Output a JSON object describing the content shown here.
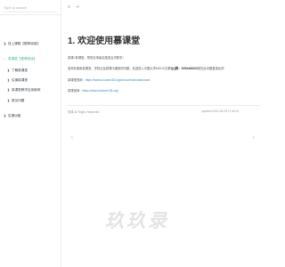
{
  "sidebar": {
    "search_placeholder": "Type to search",
    "items": [
      {
        "label": "线上课程【推荐阅读】",
        "caret": "❯",
        "active": false
      },
      {
        "label": "慕课堂【推荐阅读】",
        "caret": "⌄",
        "active": true
      },
      {
        "label": "了解慕课堂",
        "caret": "❯",
        "active": false
      },
      {
        "label": "实操慕课堂",
        "caret": "❯",
        "active": false
      },
      {
        "label": "慕课堂教学应用案例",
        "caret": "❯",
        "active": false
      },
      {
        "label": "常见问题",
        "caret": "❯",
        "active": false
      },
      {
        "label": "实操功能",
        "caret": "❯",
        "active": false
      }
    ]
  },
  "topbar": {
    "menu_icon": "≡",
    "share_icon": "⩤"
  },
  "main": {
    "title": "1. 欢迎使用慕课堂",
    "p1": "慕课+慕课堂，帮您全场景实施混合式教学！",
    "p2_prefix": "老师在使用慕课堂、学校云及慕课中遇到的问题，欢迎进入中国大学MOOC社群",
    "p2_qq": "QQ群：1053449223",
    "p2_suffix": "或在此问题直接反馈",
    "p3_label": "慕课堂官网：",
    "p3_link": "https://www.icourse163.org/mooc/main/classroom",
    "p4_label": "慕课官网：",
    "p4_link": "https://www.icourse163.org/"
  },
  "footer": {
    "left": "慕课 All Rights Reserved",
    "right": "updated 2021-06-08 17:46:13"
  },
  "nav": {
    "prev": "‹",
    "next": "›"
  },
  "watermark": "玖玖录"
}
